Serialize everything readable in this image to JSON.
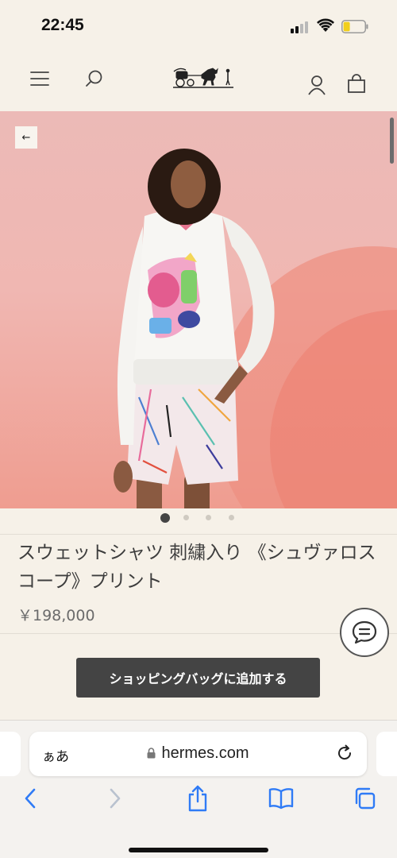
{
  "status_bar": {
    "time": "22:45"
  },
  "header": {
    "menu_icon": "menu-icon",
    "search_icon": "search-icon",
    "logo": "hermes-carriage-logo",
    "account_icon": "account-icon",
    "bag_icon": "shopping-bag-icon"
  },
  "product": {
    "title": "スウェットシャツ 刺繍入り 《シュヴァロスコープ》プリント",
    "price": "￥198,000",
    "add_to_bag": "ショッピングバッグに追加する",
    "carousel": {
      "total": 4,
      "active_index": 0
    }
  },
  "browser": {
    "aa_label": "ぁあ",
    "url": "hermes.com"
  },
  "colors": {
    "accent_dark": "#444444",
    "background": "#f6f1e8",
    "link_blue": "#2f7bf6"
  }
}
